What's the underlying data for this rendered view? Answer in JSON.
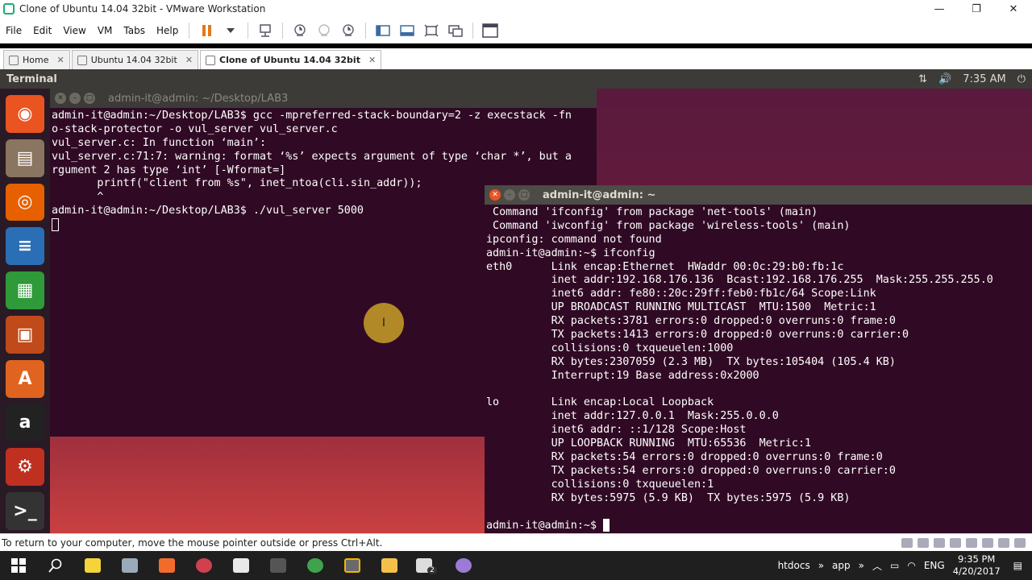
{
  "vm": {
    "title": "Clone of Ubuntu 14.04 32bit - VMware Workstation",
    "window_controls": [
      "—",
      "❐",
      "✕"
    ],
    "menu": [
      "File",
      "Edit",
      "View",
      "VM",
      "Tabs",
      "Help"
    ],
    "tabs": [
      {
        "label": "Home",
        "close": "✕"
      },
      {
        "label": "Ubuntu 14.04 32bit",
        "close": "✕"
      },
      {
        "label": "Clone of Ubuntu 14.04 32bit",
        "close": "✕"
      }
    ],
    "status_message": "To return to your computer, move the mouse pointer outside or press Ctrl+Alt."
  },
  "ubuntu_panel": {
    "title": "Terminal",
    "net_icon": "⇅",
    "sound_icon": "🔊",
    "time": "7:35 AM",
    "power_icon": "⏻"
  },
  "launcher": {
    "items": [
      {
        "name": "ubuntu-dash-icon",
        "glyph": "◉",
        "color": "#e95420"
      },
      {
        "name": "files-icon",
        "glyph": "▤",
        "color": "#8a7560"
      },
      {
        "name": "firefox-icon",
        "glyph": "◎",
        "color": "#e66000"
      },
      {
        "name": "writer-icon",
        "glyph": "≡",
        "color": "#2a6fb5"
      },
      {
        "name": "calc-icon",
        "glyph": "▦",
        "color": "#2e9a3a"
      },
      {
        "name": "impress-icon",
        "glyph": "▣",
        "color": "#c04a1a"
      },
      {
        "name": "software-center-icon",
        "glyph": "A",
        "color": "#e0641f"
      },
      {
        "name": "amazon-icon",
        "glyph": "a",
        "color": "#222"
      },
      {
        "name": "system-settings-icon",
        "glyph": "⚙",
        "color": "#c03020"
      },
      {
        "name": "terminal-icon",
        "glyph": ">_",
        "color": "#333"
      }
    ]
  },
  "terminal1": {
    "title": "admin-it@admin: ~/Desktop/LAB3",
    "lines": [
      "admin-it@admin:~/Desktop/LAB3$ gcc -mpreferred-stack-boundary=2 -z execstack -fn",
      "o-stack-protector -o vul_server vul_server.c",
      "vul_server.c: In function ‘main’:",
      "vul_server.c:71:7: warning: format ‘%s’ expects argument of type ‘char *’, but a",
      "rgument 2 has type ‘int’ [-Wformat=]",
      "       printf(\"client from %s\", inet_ntoa(cli.sin_addr));",
      "       ^",
      "admin-it@admin:~/Desktop/LAB3$ ./vul_server 5000"
    ]
  },
  "terminal2": {
    "title": "admin-it@admin: ~",
    "lines": [
      " Command 'ifconfig' from package 'net-tools' (main)",
      " Command 'iwconfig' from package 'wireless-tools' (main)",
      "ipconfig: command not found",
      "admin-it@admin:~$ ifconfig",
      "eth0      Link encap:Ethernet  HWaddr 00:0c:29:b0:fb:1c",
      "          inet addr:192.168.176.136  Bcast:192.168.176.255  Mask:255.255.255.0",
      "          inet6 addr: fe80::20c:29ff:feb0:fb1c/64 Scope:Link",
      "          UP BROADCAST RUNNING MULTICAST  MTU:1500  Metric:1",
      "          RX packets:3781 errors:0 dropped:0 overruns:0 frame:0",
      "          TX packets:1413 errors:0 dropped:0 overruns:0 carrier:0",
      "          collisions:0 txqueuelen:1000",
      "          RX bytes:2307059 (2.3 MB)  TX bytes:105404 (105.4 KB)",
      "          Interrupt:19 Base address:0x2000",
      "",
      "lo        Link encap:Local Loopback",
      "          inet addr:127.0.0.1  Mask:255.0.0.0",
      "          inet6 addr: ::1/128 Scope:Host",
      "          UP LOOPBACK RUNNING  MTU:65536  Metric:1",
      "          RX packets:54 errors:0 dropped:0 overruns:0 frame:0",
      "          TX packets:54 errors:0 dropped:0 overruns:0 carrier:0",
      "          collisions:0 txqueuelen:1",
      "          RX bytes:5975 (5.9 KB)  TX bytes:5975 (5.9 KB)",
      ""
    ],
    "prompt": "admin-it@admin:~$ "
  },
  "taskbar": {
    "tray_labels": [
      "htdocs",
      "»",
      "app",
      "»"
    ],
    "language": "ENG",
    "time": "9:35 PM",
    "date": "4/20/2017",
    "mail_badge": "2"
  },
  "colors": {
    "terminal_bg": "#300a24",
    "ubuntu_orange": "#e95420",
    "panel": "#3c3b37"
  }
}
